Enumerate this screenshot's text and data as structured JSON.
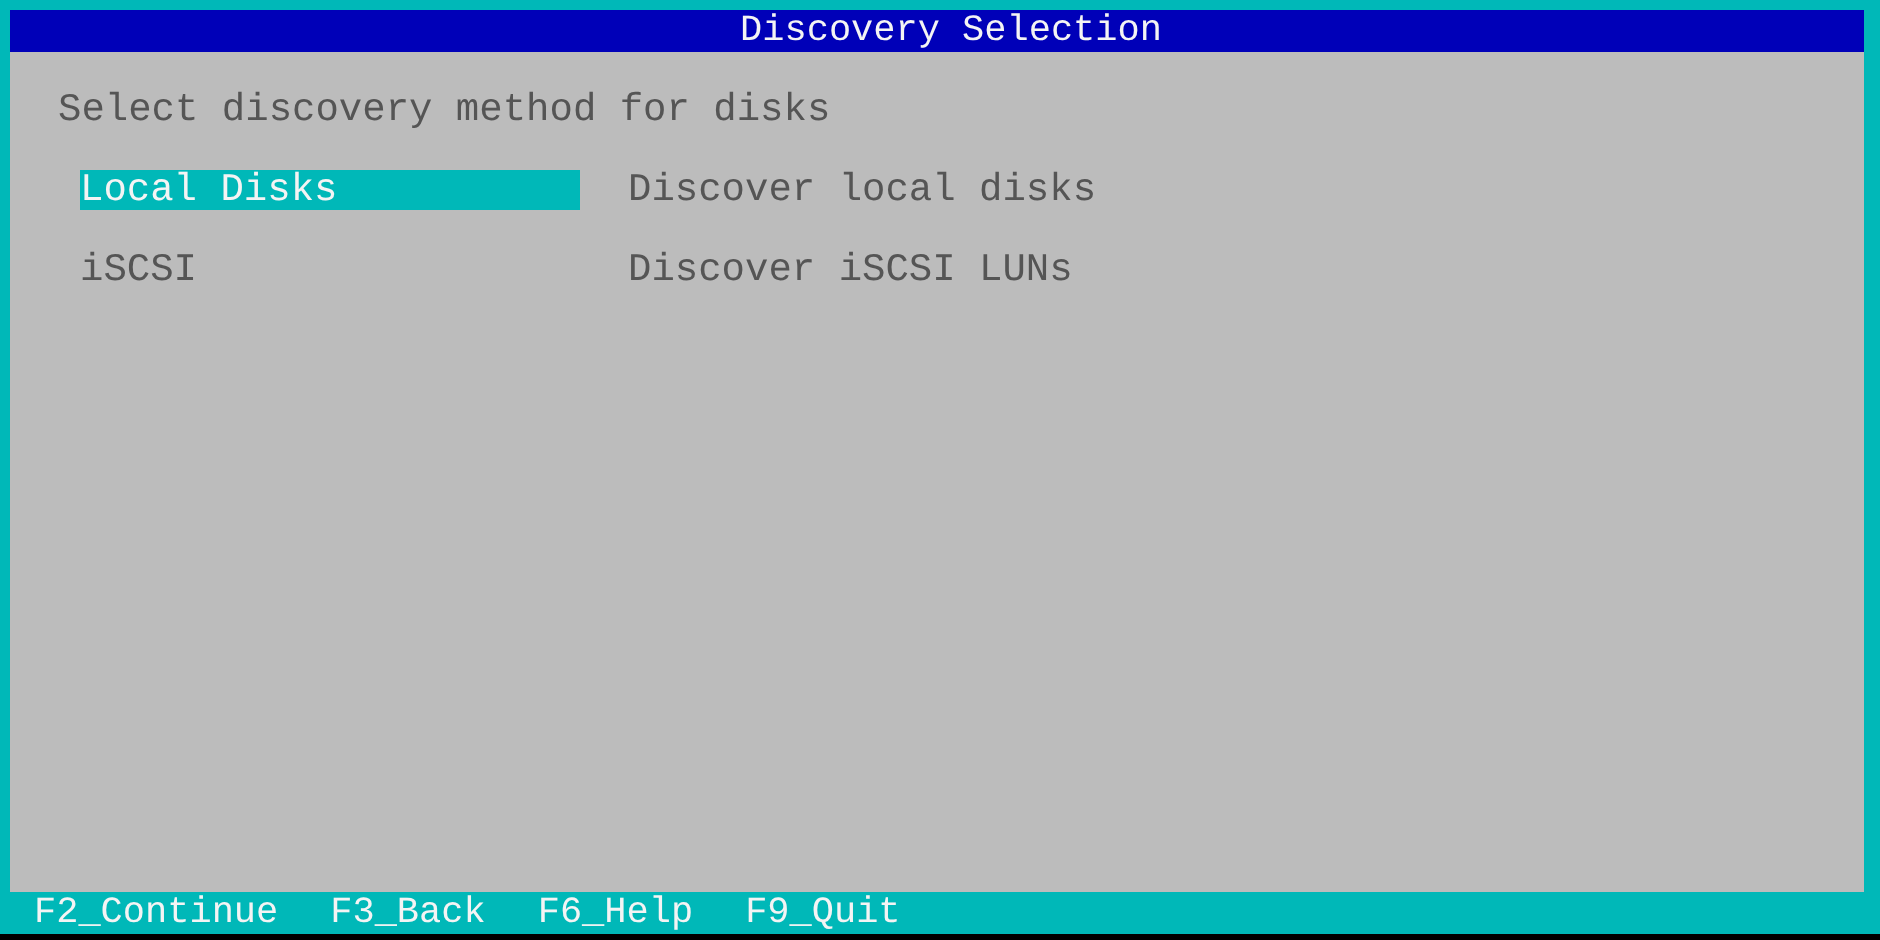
{
  "window": {
    "title": "Discovery Selection"
  },
  "prompt": "Select discovery method for disks",
  "options": [
    {
      "label": "Local Disks",
      "description": "Discover local disks",
      "selected": true
    },
    {
      "label": "iSCSI",
      "description": "Discover iSCSI LUNs",
      "selected": false
    }
  ],
  "function_keys": [
    "F2_Continue",
    "F3_Back",
    "F6_Help",
    "F9_Quit"
  ]
}
